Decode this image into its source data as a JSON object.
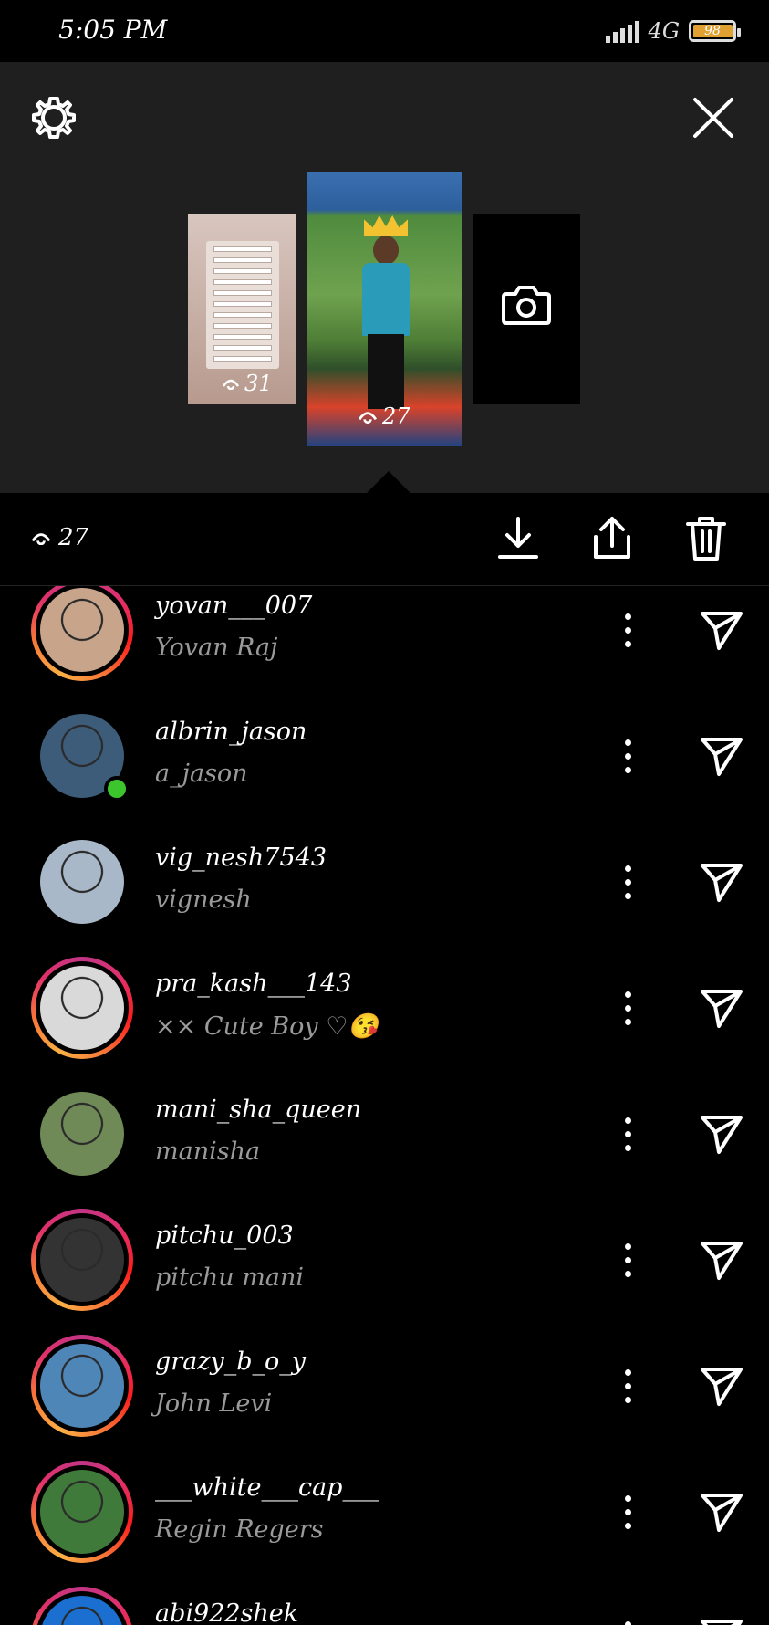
{
  "status_bar": {
    "time": "5:05 PM",
    "network": "4G",
    "battery_percent": "98",
    "battery_level": 0.98,
    "battery_color": "#e0a032"
  },
  "header": {
    "settings_icon": "gear-icon",
    "close_icon": "close-icon"
  },
  "stories": {
    "items": [
      {
        "views": "31"
      },
      {
        "views": "27",
        "selected": true
      }
    ],
    "add_icon": "camera-icon"
  },
  "action_bar": {
    "views": "27",
    "view_icon": "eye-icon",
    "download_icon": "download-icon",
    "share_icon": "share-icon",
    "delete_icon": "trash-icon"
  },
  "viewers": [
    {
      "username": "yovan___007",
      "full_name": "Yovan Raj",
      "ring": true,
      "online": false,
      "avatar_color": "#c8a58a"
    },
    {
      "username": "albrin_jason",
      "full_name": "a_jason",
      "ring": false,
      "online": true,
      "avatar_color": "#3d5c7a"
    },
    {
      "username": "vig_nesh7543",
      "full_name": "vignesh",
      "ring": false,
      "online": false,
      "avatar_color": "#a8b8c8"
    },
    {
      "username": "pra_kash___143",
      "full_name": "×× Cute Boy ♡😘",
      "ring": true,
      "online": false,
      "avatar_color": "#d9d9d9"
    },
    {
      "username": "mani_sha_queen",
      "full_name": "manisha",
      "ring": false,
      "online": false,
      "avatar_color": "#6f8a56"
    },
    {
      "username": "pitchu_003",
      "full_name": "pitchu mani",
      "ring": true,
      "online": false,
      "avatar_color": "#333333"
    },
    {
      "username": "grazy_b_o_y",
      "full_name": "John Levi",
      "ring": true,
      "online": false,
      "avatar_color": "#4f86b8"
    },
    {
      "username": "___white___cap___",
      "full_name": "Regin Regers",
      "ring": true,
      "online": false,
      "avatar_color": "#3f7a3a"
    },
    {
      "username": "abi922shek",
      "full_name": "",
      "ring": true,
      "online": false,
      "avatar_color": "#1a6fd1"
    }
  ],
  "colors": {
    "header_bg": "#1f1f1f",
    "background": "#000000",
    "online": "#3cc52d",
    "secondary_text": "#9a9a9a"
  }
}
